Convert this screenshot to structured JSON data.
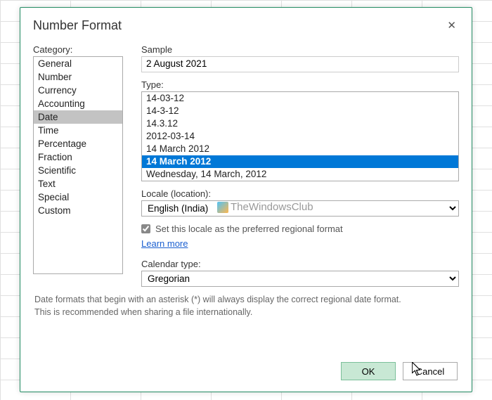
{
  "dialog": {
    "title": "Number Format",
    "category_label": "Category:",
    "categories": [
      "General",
      "Number",
      "Currency",
      "Accounting",
      "Date",
      "Time",
      "Percentage",
      "Fraction",
      "Scientific",
      "Text",
      "Special",
      "Custom"
    ],
    "selected_category_index": 4,
    "sample_label": "Sample",
    "sample_value": "2 August 2021",
    "type_label": "Type:",
    "types": [
      "14-03-12",
      "14-3-12",
      "14.3.12",
      "2012-03-14",
      "14 March 2012",
      "14 March 2012",
      "Wednesday, 14 March, 2012"
    ],
    "selected_type_index": 5,
    "locale_label": "Locale (location):",
    "locale_value": "English (India)",
    "checkbox_label": "Set this locale as the preferred regional format",
    "learn_more": "Learn more",
    "calendar_label": "Calendar type:",
    "calendar_value": "Gregorian",
    "footer_line1": "Date formats that begin with an asterisk (*) will always display the correct regional date format.",
    "footer_line2": "This is recommended when sharing a file internationally.",
    "ok": "OK",
    "cancel": "Cancel",
    "watermark": "TheWindowsClub"
  }
}
